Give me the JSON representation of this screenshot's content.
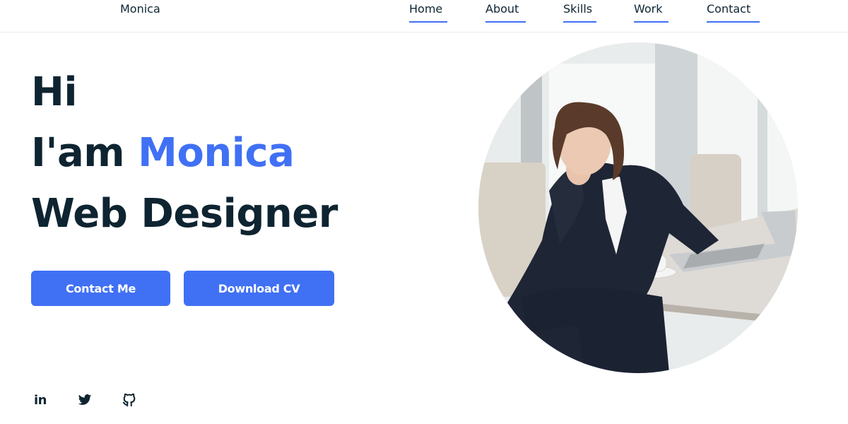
{
  "nav": {
    "logo": "Monica",
    "links": [
      "Home",
      "About",
      "Skills",
      "Work",
      "Contact"
    ]
  },
  "hero": {
    "line1": "Hi",
    "line2_prefix": "I'am ",
    "line2_name": "Monica",
    "line3": "Web Designer"
  },
  "buttons": {
    "contact": "Contact Me",
    "download": "Download CV"
  },
  "social": {
    "linkedin_text": "in",
    "icons": [
      "linkedin-icon",
      "twitter-icon",
      "github-icon"
    ]
  },
  "colors": {
    "accent": "#4070f4",
    "text": "#0e2431",
    "background": "#ffffff"
  }
}
